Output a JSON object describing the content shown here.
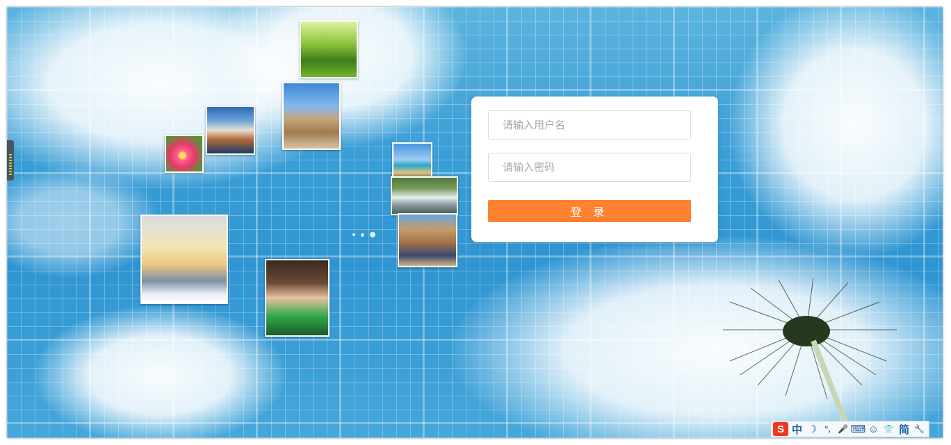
{
  "login": {
    "username_placeholder": "请输入用户名",
    "password_placeholder": "请输入密码",
    "submit_label": "登 录"
  },
  "ime_toolbar": {
    "logo": "S",
    "items": [
      {
        "icon": "chinese-mode-icon",
        "glyph": "中"
      },
      {
        "icon": "half-width-moon-icon",
        "glyph": "☽"
      },
      {
        "icon": "punctuation-icon",
        "glyph": "°,"
      },
      {
        "icon": "microphone-icon",
        "glyph": "🎤"
      },
      {
        "icon": "keyboard-icon",
        "glyph": "⌨"
      },
      {
        "icon": "user-icon",
        "glyph": "☺"
      },
      {
        "icon": "skin-shirt-icon",
        "glyph": "👕"
      },
      {
        "icon": "simplified-icon",
        "glyph": "简"
      },
      {
        "icon": "wrench-icon",
        "glyph": "🔧"
      }
    ]
  },
  "colors": {
    "accent": "#ff8231",
    "sky": "#3a9ed6",
    "card": "#ffffff",
    "ime_logo": "#f0361f"
  }
}
